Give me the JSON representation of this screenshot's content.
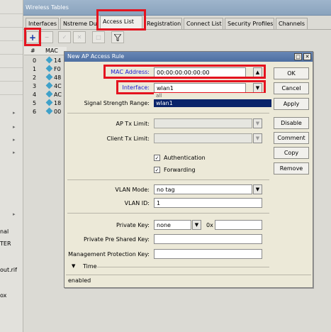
{
  "wireless_tables": {
    "title": "Wireless Tables",
    "tabs": [
      "Interfaces",
      "Nstreme Dual",
      "Access List",
      "Registration",
      "Connect List",
      "Security Profiles",
      "Channels"
    ],
    "list": {
      "header_num": "#",
      "header_mac": "MAC",
      "rows": [
        {
          "num": "0",
          "mac": "14"
        },
        {
          "num": "1",
          "mac": "F0"
        },
        {
          "num": "2",
          "mac": "48"
        },
        {
          "num": "3",
          "mac": "4C"
        },
        {
          "num": "4",
          "mac": "AC"
        },
        {
          "num": "5",
          "mac": "18"
        },
        {
          "num": "6",
          "mac": "00"
        }
      ]
    }
  },
  "left_strip": {
    "items": [
      "nal",
      "TER",
      "out.rif",
      "ox"
    ]
  },
  "dialog": {
    "title": "New AP Access Rule",
    "mac_address": {
      "label": "MAC Address:",
      "value": "00:00:00:00:00:00"
    },
    "interface": {
      "label": "Interface:",
      "value": "wlan1",
      "options": [
        "all",
        "wlan1"
      ]
    },
    "signal_strength_range": {
      "label": "Signal Strength Range:"
    },
    "ap_tx_limit": {
      "label": "AP Tx Limit:"
    },
    "client_tx_limit": {
      "label": "Client Tx Limit:"
    },
    "authentication": {
      "label": "Authentication",
      "checked": true
    },
    "forwarding": {
      "label": "Forwarding",
      "checked": true
    },
    "vlan_mode": {
      "label": "VLAN Mode:",
      "value": "no tag"
    },
    "vlan_id": {
      "label": "VLAN ID:",
      "value": "1"
    },
    "private_key": {
      "label": "Private Key:",
      "type": "none",
      "prefix": "0x",
      "value": ""
    },
    "private_pre_shared_key": {
      "label": "Private Pre Shared Key:",
      "value": ""
    },
    "management_protection_key": {
      "label": "Management Protection Key:",
      "value": ""
    },
    "time_section": {
      "label": "Time"
    },
    "status": "enabled",
    "buttons": {
      "ok": "OK",
      "cancel": "Cancel",
      "apply": "Apply",
      "disable": "Disable",
      "comment": "Comment",
      "copy": "Copy",
      "remove": "Remove"
    }
  },
  "colors": {
    "highlight_red": "#e4131f",
    "dialog_title_bg": "#4d6fa2",
    "selected_item_bg": "#0a246a",
    "label_blue": "#1a1ad0"
  },
  "icons": {
    "add": "plus-icon",
    "remove": "minus-icon",
    "enable": "check-icon",
    "disable": "x-icon",
    "comment": "note-icon",
    "filter": "filter-icon",
    "mac": "diamond-icon"
  }
}
